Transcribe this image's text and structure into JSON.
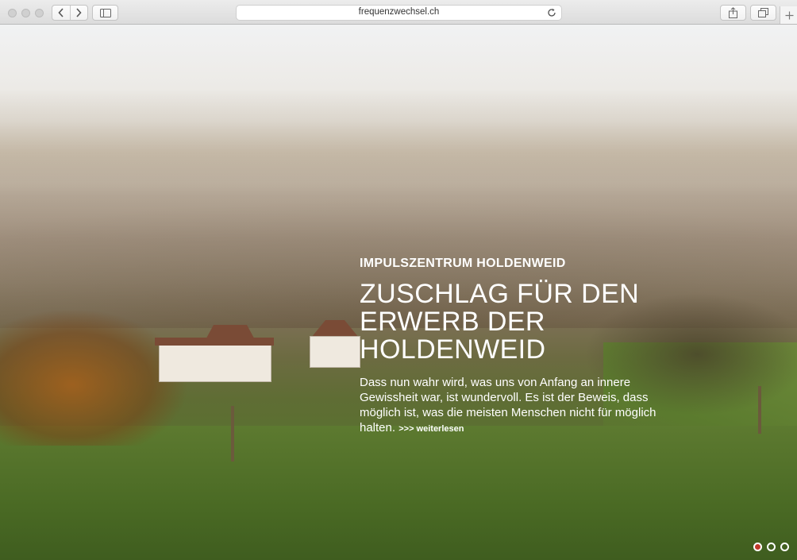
{
  "browser": {
    "url": "frequenzwechsel.ch",
    "icons": [
      "chevron-left-icon",
      "chevron-right-icon",
      "sidebar-icon",
      "reload-icon",
      "share-icon",
      "tabs-icon",
      "plus-icon"
    ]
  },
  "hero": {
    "kicker": "IMPULSZENTRUM HOLDENWEID",
    "headline": "ZUSCHLAG FÜR DEN ERWERB DER HOLDENWEID",
    "body": "Dass nun wahr wird, was uns von Anfang an innere Gewissheit war, ist wundervoll. Es ist der Beweis, dass möglich ist, was die meisten Menschen nicht für möglich halten.",
    "read_more": ">>> weiterlesen"
  },
  "carousel": {
    "slides": 3,
    "active_index": 0,
    "active_color": "#c0392b"
  }
}
